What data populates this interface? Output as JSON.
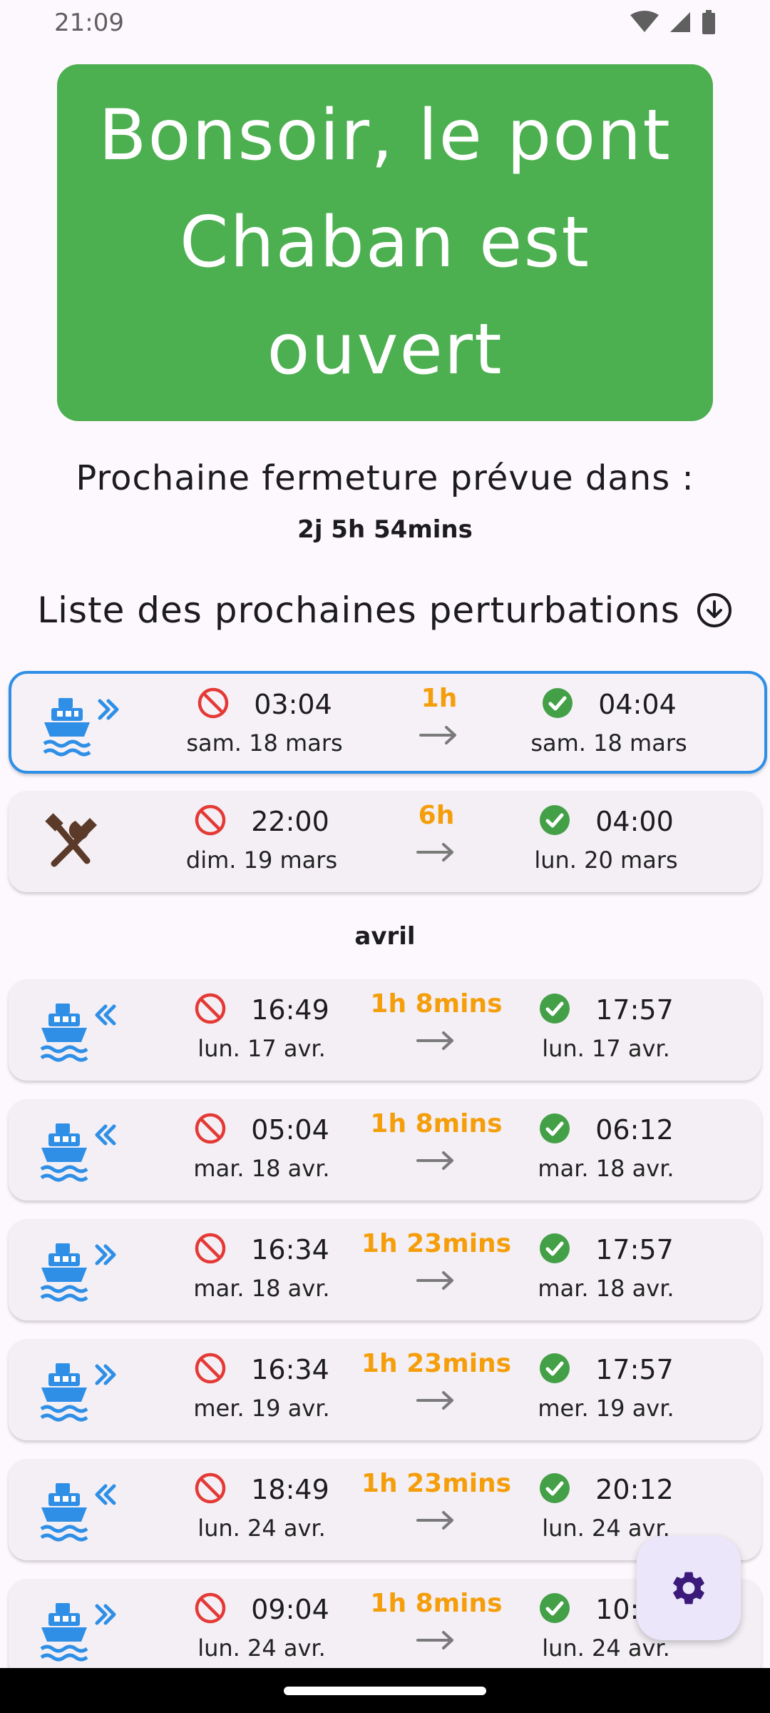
{
  "status_bar": {
    "time": "21:09"
  },
  "hero": {
    "text": "Bonsoir, le pont Chaban est ouvert",
    "color": "#4caf50"
  },
  "next_closure": {
    "label": "Prochaine fermeture prévue dans :",
    "value": "2j 5h 54mins"
  },
  "list": {
    "title": "Liste des prochaines perturbations",
    "month_separator": "avril",
    "items": [
      {
        "type": "boat-outgoing",
        "start_time": "03:04",
        "start_date": "sam. 18 mars",
        "duration": "1h",
        "end_time": "04:04",
        "end_date": "sam. 18 mars",
        "highlighted": true
      },
      {
        "type": "maintenance",
        "start_time": "22:00",
        "start_date": "dim. 19 mars",
        "duration": "6h",
        "end_time": "04:00",
        "end_date": "lun. 20 mars"
      },
      {
        "type": "boat-incoming",
        "start_time": "16:49",
        "start_date": "lun. 17 avr.",
        "duration": "1h 8mins",
        "end_time": "17:57",
        "end_date": "lun. 17 avr."
      },
      {
        "type": "boat-incoming",
        "start_time": "05:04",
        "start_date": "mar. 18 avr.",
        "duration": "1h 8mins",
        "end_time": "06:12",
        "end_date": "mar. 18 avr."
      },
      {
        "type": "boat-outgoing",
        "start_time": "16:34",
        "start_date": "mar. 18 avr.",
        "duration": "1h 23mins",
        "end_time": "17:57",
        "end_date": "mar. 18 avr."
      },
      {
        "type": "boat-outgoing",
        "start_time": "16:34",
        "start_date": "mer. 19 avr.",
        "duration": "1h 23mins",
        "end_time": "17:57",
        "end_date": "mer. 19 avr."
      },
      {
        "type": "boat-incoming",
        "start_time": "18:49",
        "start_date": "lun. 24 avr.",
        "duration": "1h 23mins",
        "end_time": "20:12",
        "end_date": "lun. 24 avr."
      },
      {
        "type": "boat-outgoing",
        "start_time": "09:04",
        "start_date": "lun. 24 avr.",
        "duration": "1h 8mins",
        "end_time": "10:12",
        "end_date": "lun. 24 avr."
      }
    ]
  },
  "colors": {
    "accent_blue": "#2f8fe6",
    "closed_red": "#e53935",
    "open_green": "#43a047",
    "duration_orange": "#f59e0b",
    "fab_icon": "#3b1a7a"
  }
}
